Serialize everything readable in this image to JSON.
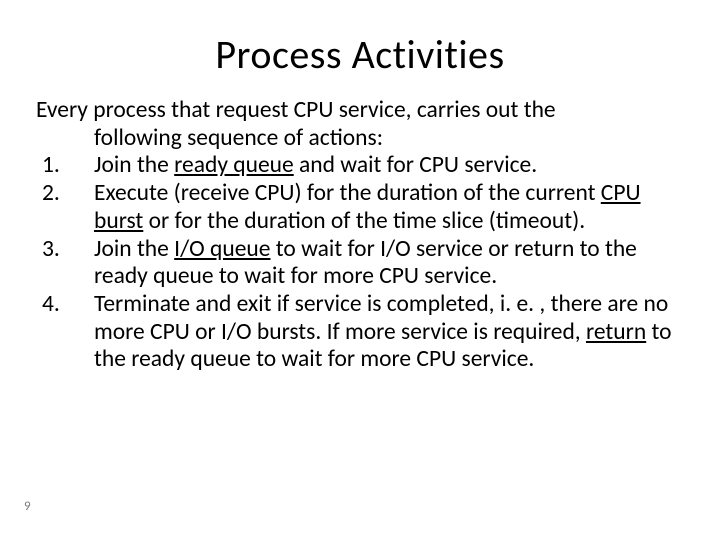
{
  "title": "Process Activities",
  "intro": {
    "line1": "Every process that request CPU service, carries out the",
    "line2": "following sequence of actions:"
  },
  "items": [
    {
      "num": "1.",
      "pre": "Join the ",
      "u1": "ready queue",
      "post": " and wait for CPU service."
    },
    {
      "num": "2.",
      "pre": "Execute (receive CPU) for the duration of the current ",
      "u1": "CPU burst",
      "post": " or for the duration of the time slice (timeout)."
    },
    {
      "num": "3.",
      "pre": "Join the ",
      "u1": "I/O queue",
      "post": " to wait for I/O service or return to the ready queue to wait for more CPU service."
    },
    {
      "num": "4.",
      "pre": "Terminate and exit if service is completed, i. e. , there are no more CPU or I/O bursts. If more service is required, ",
      "u1": "return",
      "post": " to the ready queue to wait for more CPU service."
    }
  ],
  "page_number": "9"
}
